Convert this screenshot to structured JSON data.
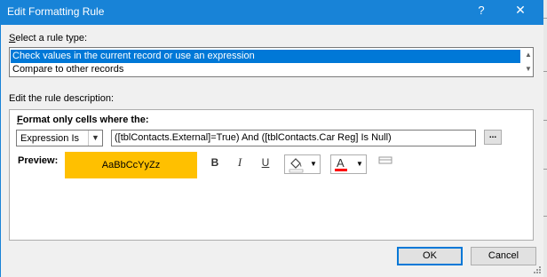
{
  "window": {
    "title": "Edit Formatting Rule",
    "help_glyph": "?",
    "close_glyph": "✕"
  },
  "rule_type": {
    "label": "Select a rule type:",
    "items": [
      {
        "label": "Check values in the current record or use an expression",
        "selected": true
      },
      {
        "label": "Compare to other records",
        "selected": false
      }
    ]
  },
  "description": {
    "label": "Edit the rule description:",
    "format_only_label": "Format only cells where the:",
    "condition_dropdown": {
      "value": "Expression Is"
    },
    "expression": "([tblContacts.External]=True) And ([tblContacts.Car Reg] Is Null)",
    "build_button": "...",
    "preview_label": "Preview:",
    "preview_sample": "AaBbCcYyZz",
    "preview_fill_color": "#ffc000",
    "toolbar": {
      "bold": "B",
      "italic": "I",
      "underline": "U",
      "font_color_letter": "A",
      "font_color": "#ff0000",
      "fill_color_icon": "paint-bucket-icon"
    }
  },
  "buttons": {
    "ok": "OK",
    "cancel": "Cancel"
  },
  "colors": {
    "title_bar": "#1883d7",
    "selection": "#0078d7",
    "dialog_bg": "#f0f0f0"
  }
}
